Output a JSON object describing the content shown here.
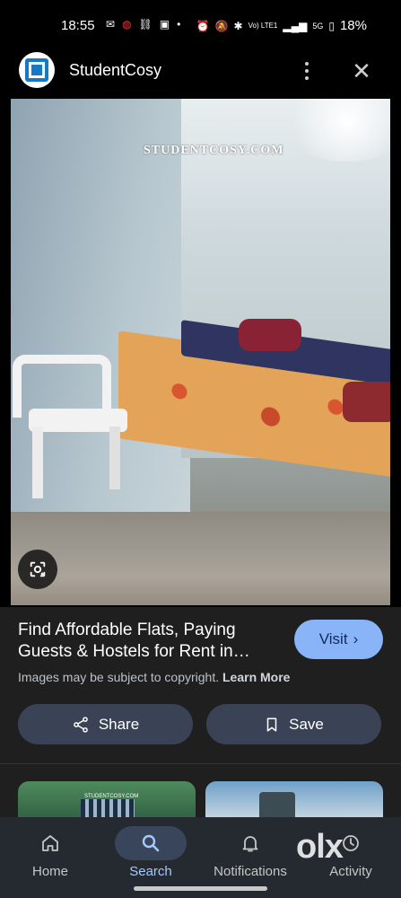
{
  "status_bar": {
    "time": "18:55",
    "left_icons": [
      "messages-icon",
      "airtel-icon",
      "link-icon",
      "news-icon",
      "dot-icon"
    ],
    "right_icons": [
      "alarm-icon",
      "mute-icon",
      "bluetooth-icon",
      "volte-icon",
      "signal-icon",
      "5g-signal-icon"
    ],
    "network_label": "Vo) LTE1",
    "network_label2": "5G",
    "battery": "18%"
  },
  "header": {
    "site_name": "StudentCosy",
    "logo_icon": "studentcosy-logo-icon",
    "more_icon": "more-vert-icon",
    "close_icon": "close-icon"
  },
  "image": {
    "watermark": "STUDENTCOSY.COM",
    "lens_icon": "google-lens-icon"
  },
  "result": {
    "title": "Find Affordable Flats, Paying Guests & Hostels for Rent in…",
    "visit_label": "Visit",
    "copyright_text": "Images may be subject to copyright.",
    "learn_more": "Learn More",
    "share_label": "Share",
    "save_label": "Save"
  },
  "related": {
    "thumb1_text": "STUDENTCOSY.COM"
  },
  "bottom_nav": {
    "items": [
      {
        "label": "Home",
        "icon": "home-icon"
      },
      {
        "label": "Search",
        "icon": "search-icon"
      },
      {
        "label": "Notifications",
        "icon": "bell-icon"
      },
      {
        "label": "Activity",
        "icon": "activity-icon"
      }
    ],
    "watermark": "olx"
  },
  "colors": {
    "accent": "#8ab4f8",
    "button_bg": "#3a4356",
    "surface": "#1f1f1f",
    "nav_bg": "#252a31"
  }
}
